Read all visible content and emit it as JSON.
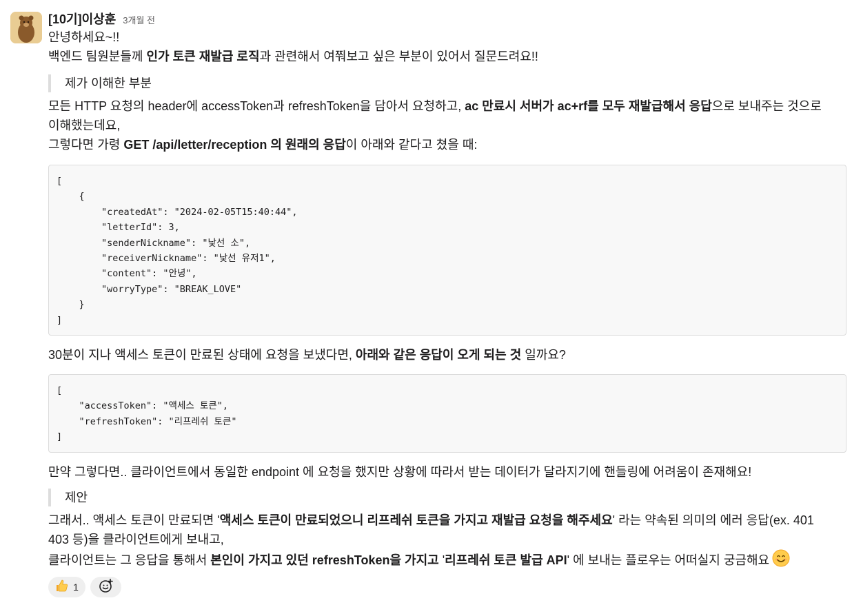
{
  "message": {
    "author": "[10기]이상훈",
    "time": "3개월 전",
    "greeting": "안녕하세요~!!",
    "intro_pre": "백엔드 팀원분들께 ",
    "intro_bold": "인가 토큰 재발급 로직",
    "intro_post": "과 관련해서 여쭤보고 싶은 부분이 있어서 질문드려요!!",
    "quote1": "제가 이해한 부분",
    "p1_pre": "모든 HTTP 요청의 header에 accessToken과 refreshToken을 담아서 요청하고, ",
    "p1_bold": "ac 만료시 서버가 ac+rf를 모두 재발급해서 응답",
    "p1_post": "으로 보내주는 것으로",
    "p1_line2": "이해했는데요,",
    "p2_pre": "그렇다면 가령 ",
    "p2_bold": "GET /api/letter/reception 의 원래의 응답",
    "p2_post": "이 아래와 같다고 쳤을 때:",
    "code1": "[\n    {\n        \"createdAt\": \"2024-02-05T15:40:44\",\n        \"letterId\": 3,\n        \"senderNickname\": \"낯선 소\",\n        \"receiverNickname\": \"낯선 유저1\",\n        \"content\": \"안녕\",\n        \"worryType\": \"BREAK_LOVE\"\n    }\n]",
    "p3_pre": "30분이 지나 액세스 토큰이 만료된 상태에 요청을 보냈다면, ",
    "p3_bold": "아래와 같은 응답이 오게 되는 것",
    "p3_post": " 일까요?",
    "code2": "[\n    \"accessToken\": \"액세스 토큰\",\n    \"refreshToken\": \"리프레쉬 토큰\"\n]",
    "p4": "만약 그렇다면.. 클라이언트에서 동일한 endpoint 에 요청을 했지만 상황에 따라서 받는 데이터가 달라지기에 핸들링에 어려움이 존재해요!",
    "quote2": "제안",
    "p5_pre": "그래서.. 액세스 토큰이 만료되면 '",
    "p5_bold": "액세스 토큰이 만료되었으니 리프레쉬 토큰을 가지고 재발급 요청을 해주세요",
    "p5_post": "' 라는 약속된 의미의 에러 응답(ex. 401",
    "p5_line2": "403 등)을 클라이언트에게 보내고,",
    "p6_pre": "클라이언트는 그 응답을 통해서 ",
    "p6_bold1": "본인이 가지고 있던 refreshToken을 가지고",
    "p6_mid": " '",
    "p6_bold2": "리프레쉬 토큰 발급 API",
    "p6_post": "' 에 보내는 플로우는 어떠실지 궁금해요"
  },
  "reactions": [
    {
      "icon": "thumbs-up-icon",
      "count": "1"
    }
  ],
  "colors": {
    "text": "#1d1c1d",
    "muted": "#616061",
    "code_bg": "#f8f8f8",
    "quote_bar": "#dddddd",
    "reaction_bg": "#efefef"
  }
}
